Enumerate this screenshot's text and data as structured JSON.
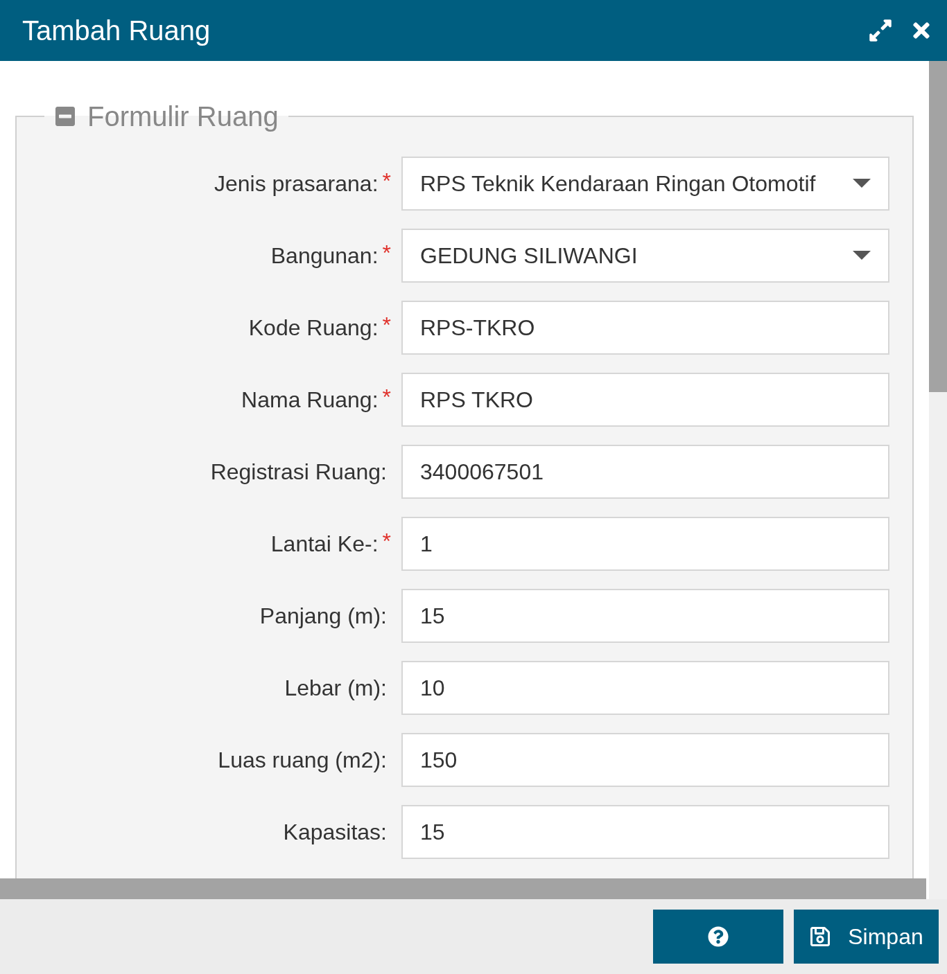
{
  "dialog": {
    "title": "Tambah Ruang",
    "controls": [
      {
        "kind": "maximize"
      },
      {
        "kind": "close"
      }
    ]
  },
  "form": {
    "legend": "Formulir Ruang",
    "collapsed": false,
    "required_mark": "*",
    "fields": [
      {
        "label": "Jenis prasarana:",
        "value": "RPS Teknik Kendaraan Ringan Otomotif",
        "required": true,
        "kind": "select"
      },
      {
        "label": "Bangunan:",
        "value": "GEDUNG SILIWANGI",
        "required": true,
        "kind": "select"
      },
      {
        "label": "Kode Ruang:",
        "value": "RPS-TKRO",
        "required": true,
        "kind": "text"
      },
      {
        "label": "Nama Ruang:",
        "value": "RPS TKRO",
        "required": true,
        "kind": "text"
      },
      {
        "label": "Registrasi Ruang:",
        "value": "3400067501",
        "required": false,
        "kind": "text"
      },
      {
        "label": "Lantai Ke-:",
        "value": "1",
        "required": true,
        "kind": "text"
      },
      {
        "label": "Panjang (m):",
        "value": "15",
        "required": false,
        "kind": "text"
      },
      {
        "label": "Lebar (m):",
        "value": "10",
        "required": false,
        "kind": "text"
      },
      {
        "label": "Luas ruang (m2):",
        "value": "150",
        "required": false,
        "kind": "text"
      },
      {
        "label": "Kapasitas:",
        "value": "15",
        "required": false,
        "kind": "text"
      }
    ]
  },
  "footer": {
    "buttons": [
      {
        "kind": "help"
      },
      {
        "kind": "save",
        "label": "Simpan"
      }
    ]
  }
}
